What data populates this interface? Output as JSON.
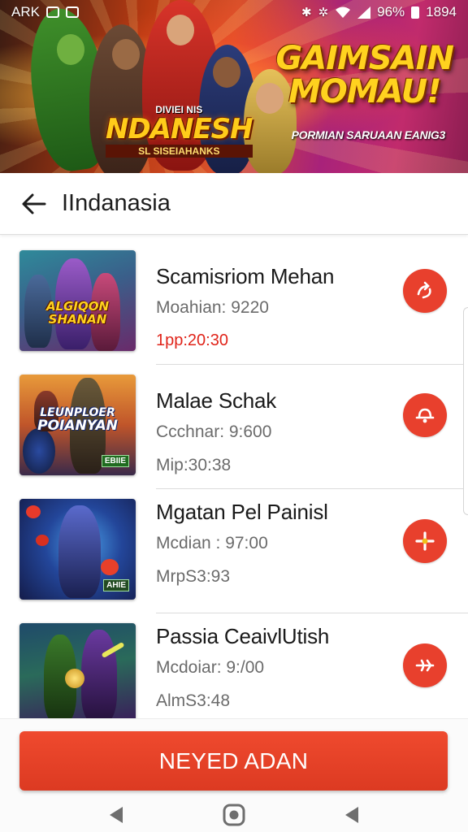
{
  "status_bar": {
    "carrier": "ARK",
    "battery": "96%",
    "time": "1894"
  },
  "banner": {
    "game_logo_top": "DIVIEI NIS",
    "game_logo": "NDANESH",
    "game_logo_bottom": "SL SISEIAHANKS",
    "promo_title_line1": "GAIMSAIN",
    "promo_title_line2": "MOMAU!",
    "promo_subtitle": "PORMIAN SARUAAN EANIG3"
  },
  "header": {
    "title": "IIndanasia"
  },
  "games": [
    {
      "thumb_text_line1": "ALGIQON",
      "thumb_text_line2": "SHANAN",
      "thumb_badge": "",
      "title": "Scamisriom Mehan",
      "subtitle": "Moahian: 9220",
      "time": "1pp:20:30",
      "time_highlight": true,
      "action_icon": "share-arrows-icon"
    },
    {
      "thumb_text_line1": "LEUNPLOER",
      "thumb_text_line2": "POIANYAN",
      "thumb_badge": "EBIIE",
      "title": "Malae Schak",
      "subtitle": "Ccchnar: 9:600",
      "time": "Mip:30:38",
      "time_highlight": false,
      "action_icon": "bell-icon"
    },
    {
      "thumb_text_line1": "",
      "thumb_text_line2": "",
      "thumb_badge": "AHIE",
      "title": "Mgatan Pel Painisl",
      "subtitle": "Mcdian : 97:00",
      "time": "MrpS3:93",
      "time_highlight": false,
      "action_icon": "plus-icon"
    },
    {
      "thumb_text_line1": "",
      "thumb_text_line2": "",
      "thumb_badge": "",
      "title": "Passia CeaivlUtish",
      "subtitle": "Mcdoiar: 9:/00",
      "time": "AlmS3:48",
      "time_highlight": false,
      "action_icon": "share-arrows-icon"
    }
  ],
  "cta": {
    "label": "NEYED ADAN"
  },
  "colors": {
    "accent": "#e8402d",
    "highlight_text": "#e0241a",
    "promo_yellow": "#ffd21f"
  }
}
